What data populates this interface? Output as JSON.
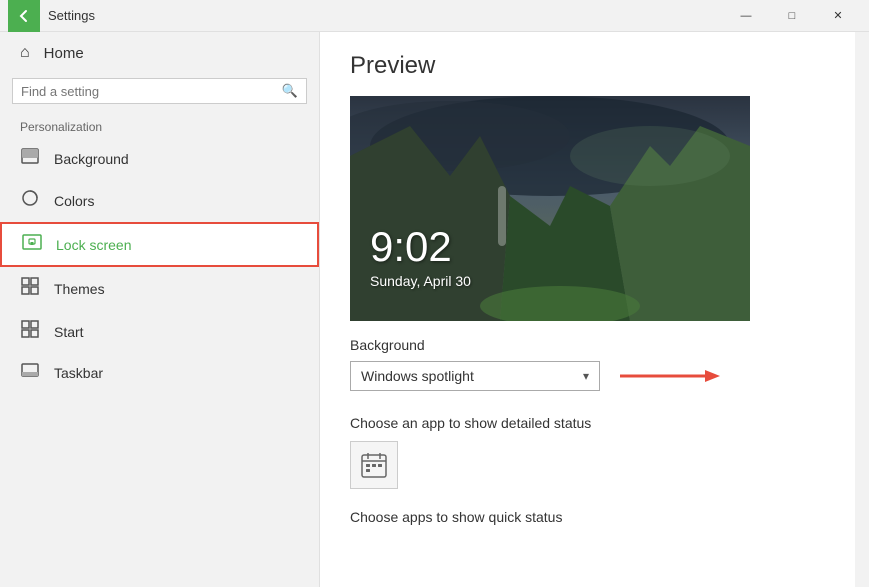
{
  "titleBar": {
    "title": "Settings",
    "backLabel": "←",
    "minimizeLabel": "—",
    "maximizeLabel": "□",
    "closeLabel": "✕"
  },
  "sidebar": {
    "homeLabel": "Home",
    "searchPlaceholder": "Find a setting",
    "sectionLabel": "Personalization",
    "items": [
      {
        "id": "background",
        "label": "Background",
        "icon": "▣"
      },
      {
        "id": "colors",
        "label": "Colors",
        "icon": "◎"
      },
      {
        "id": "lock-screen",
        "label": "Lock screen",
        "icon": "🖥",
        "active": true
      },
      {
        "id": "themes",
        "label": "Themes",
        "icon": "◈"
      },
      {
        "id": "start",
        "label": "Start",
        "icon": "⊞"
      },
      {
        "id": "taskbar",
        "label": "Taskbar",
        "icon": "▭"
      }
    ]
  },
  "content": {
    "previewTitle": "Preview",
    "previewTime": "9:02",
    "previewDate": "Sunday, April 30",
    "backgroundLabel": "Background",
    "dropdownValue": "Windows spotlight",
    "detailedStatusLabel": "Choose an app to show detailed status",
    "quickStatusLabel": "Choose apps to show quick status"
  }
}
